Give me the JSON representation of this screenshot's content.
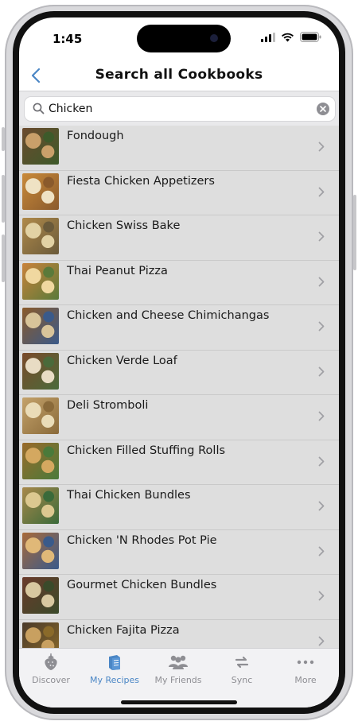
{
  "status_bar": {
    "time": "1:45"
  },
  "header": {
    "title": "Search all Cookbooks",
    "back_icon": "chevron-left-icon"
  },
  "search": {
    "value": "Chicken",
    "placeholder": ""
  },
  "recipes": [
    {
      "title": "Fondough",
      "thumb_colors": [
        "#6b4a2e",
        "#c9a06a",
        "#3d5a2a"
      ]
    },
    {
      "title": "Fiesta Chicken Appetizers",
      "thumb_colors": [
        "#c98a3a",
        "#efe2c4",
        "#8a5a2c"
      ]
    },
    {
      "title": "Chicken Swiss Bake",
      "thumb_colors": [
        "#b08a4a",
        "#e2d2a4",
        "#6a5a3a"
      ]
    },
    {
      "title": "Thai Peanut Pizza",
      "thumb_colors": [
        "#c9823a",
        "#f0d8a0",
        "#5a7a3a"
      ]
    },
    {
      "title": "Chicken and Cheese Chimichangas",
      "thumb_colors": [
        "#8a5a2a",
        "#d8c49a",
        "#3a5a8a"
      ]
    },
    {
      "title": "Chicken Verde Loaf",
      "thumb_colors": [
        "#7a4a2a",
        "#e8dcc4",
        "#4a6a3a"
      ]
    },
    {
      "title": "Deli Stromboli",
      "thumb_colors": [
        "#c4a26a",
        "#eadcb8",
        "#8a6a3a"
      ]
    },
    {
      "title": "Chicken Filled Stuffing Rolls",
      "thumb_colors": [
        "#9a6a2a",
        "#d4a860",
        "#4a7a3a"
      ]
    },
    {
      "title": "Thai Chicken Bundles",
      "thumb_colors": [
        "#a8884a",
        "#dcc890",
        "#3a6a3a"
      ]
    },
    {
      "title": "Chicken 'N Rhodes Pot Pie",
      "thumb_colors": [
        "#a86a3a",
        "#e0b878",
        "#3a5a8a"
      ]
    },
    {
      "title": "Gourmet Chicken Bundles",
      "thumb_colors": [
        "#6a3a2a",
        "#d8c8a0",
        "#3a4a2a"
      ]
    },
    {
      "title": "Chicken Fajita Pizza",
      "thumb_colors": [
        "#4a3a2a",
        "#c8a060",
        "#8a6a2a"
      ]
    }
  ],
  "tabs": [
    {
      "label": "Discover",
      "icon": "strawberry-icon",
      "active": false
    },
    {
      "label": "My Recipes",
      "icon": "recipe-book-icon",
      "active": true
    },
    {
      "label": "My Friends",
      "icon": "people-icon",
      "active": false
    },
    {
      "label": "Sync",
      "icon": "sync-arrows-icon",
      "active": false
    },
    {
      "label": "More",
      "icon": "more-dots-icon",
      "active": false
    }
  ],
  "colors": {
    "accent": "#4a86c5",
    "inactive": "#8e8e93",
    "list_bg": "#dedede"
  }
}
